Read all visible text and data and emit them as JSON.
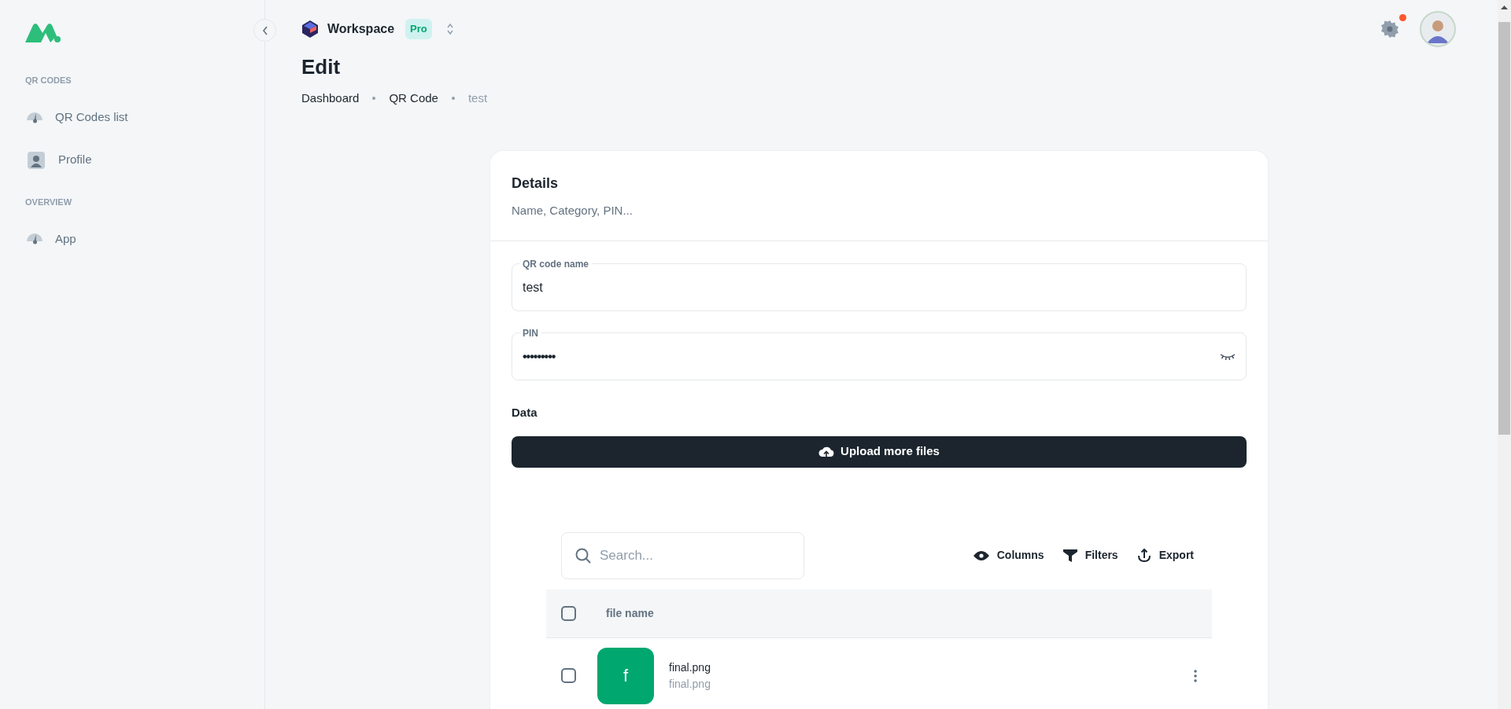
{
  "sidebar": {
    "sections": [
      {
        "title": "QR CODES",
        "items": [
          {
            "label": "QR Codes list",
            "kind": "gauge",
            "selected": false
          },
          {
            "label": "Profile",
            "kind": "user",
            "selected": false
          }
        ]
      },
      {
        "title": "OVERVIEW",
        "items": [
          {
            "label": "App",
            "kind": "gauge",
            "selected": false
          }
        ]
      }
    ]
  },
  "header": {
    "workspace": "Workspace",
    "plan": "Pro",
    "notification": true
  },
  "page": {
    "title": "Edit",
    "breadcrumbs": [
      "Dashboard",
      "QR Code",
      "test"
    ]
  },
  "card": {
    "title": "Details",
    "subtitle": "Name, Category, PIN...",
    "fields": [
      {
        "label": "QR code name",
        "value": "test",
        "kind": "text"
      },
      {
        "label": "PIN",
        "value": "•••••••••",
        "kind": "password"
      }
    ],
    "data_label": "Data",
    "upload_button": "Upload more files"
  },
  "table": {
    "search_placeholder": "Search...",
    "actions": [
      {
        "label": "Columns",
        "kind": "eye"
      },
      {
        "label": "Filters",
        "kind": "filter"
      },
      {
        "label": "Export",
        "kind": "export"
      }
    ],
    "columns": [
      "file name"
    ],
    "header_checked": false,
    "rows": [
      {
        "initial": "f",
        "name": "final.png",
        "subtitle": "final.png",
        "checked": false,
        "color": "#00a76f"
      }
    ]
  }
}
